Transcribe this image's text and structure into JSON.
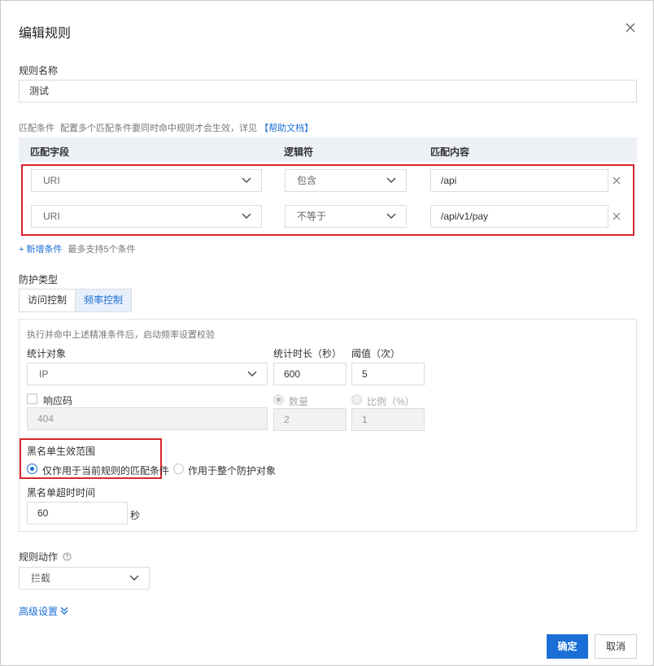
{
  "dialog": {
    "title": "编辑规则",
    "close_icon": "close-icon"
  },
  "rule_name": {
    "label": "规则名称",
    "value": "测试"
  },
  "match": {
    "label": "匹配条件",
    "hint": "配置多个匹配条件要同时命中规则才会生效，详见",
    "help_link": "【帮助文档】",
    "columns": [
      "匹配字段",
      "逻辑符",
      "匹配内容"
    ],
    "rows": [
      {
        "field": "URI",
        "operator": "包含",
        "content": "/api"
      },
      {
        "field": "URI",
        "operator": "不等于",
        "content": "/api/v1/pay"
      }
    ],
    "add_label": "+ 新增条件",
    "add_hint": "最多支持5个条件"
  },
  "protection": {
    "label": "防护类型",
    "tabs": [
      "访问控制",
      "频率控制"
    ],
    "active_tab": "频率控制",
    "desc": "执行并命中上述精准条件后，启动频率设置校验",
    "stat_object_label": "统计对象",
    "stat_object_value": "IP",
    "duration_label": "统计时长（秒）",
    "duration_value": "600",
    "threshold_label": "阈值（次）",
    "threshold_value": "5",
    "response_code_label": "响应码",
    "response_code_value": "404",
    "count_label": "数量",
    "count_value": "2",
    "ratio_label": "比例（%）",
    "ratio_value": "1",
    "blacklist_scope_label": "黑名单生效范围",
    "scope_option_1": "仅作用于当前规则的匹配条件",
    "scope_option_2": "作用于整个防护对象",
    "blacklist_timeout_label": "黑名单超时时间",
    "blacklist_timeout_value": "60",
    "timeout_unit": "秒"
  },
  "action": {
    "label": "规则动作",
    "value": "拦截"
  },
  "advanced": {
    "label": "高级设置"
  },
  "footer": {
    "confirm": "确定",
    "cancel": "取消"
  },
  "colors": {
    "accent": "#1a6fd6",
    "highlight_border": "#d9262b",
    "header_bg": "#edf0f5"
  }
}
